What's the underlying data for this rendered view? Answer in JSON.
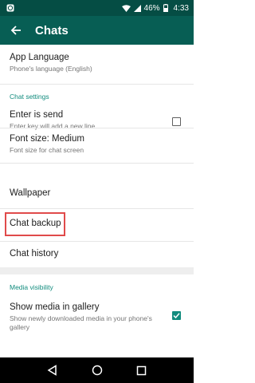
{
  "status_bar": {
    "battery": "46%",
    "time": "4:33"
  },
  "app_bar": {
    "title": "Chats"
  },
  "settings": {
    "app_language": {
      "title": "App Language",
      "subtitle": "Phone's language (English)"
    },
    "chat_settings_header": "Chat settings",
    "enter_is_send": {
      "title": "Enter is send",
      "subtitle": "Enter key will add a new line",
      "checked": false
    },
    "font_size": {
      "title": "Font size: Medium",
      "subtitle": "Font size for chat screen"
    },
    "wallpaper": {
      "title": "Wallpaper"
    },
    "chat_backup": {
      "title": "Chat backup"
    },
    "chat_history": {
      "title": "Chat history"
    },
    "media_visibility_header": "Media visibility",
    "show_media": {
      "title": "Show media in gallery",
      "subtitle": "Show newly downloaded media in your phone's gallery",
      "checked": true
    }
  },
  "colors": {
    "status_bar": "#054d44",
    "app_bar": "#075e54",
    "accent": "#128c7e",
    "highlight": "#e04a4a"
  }
}
